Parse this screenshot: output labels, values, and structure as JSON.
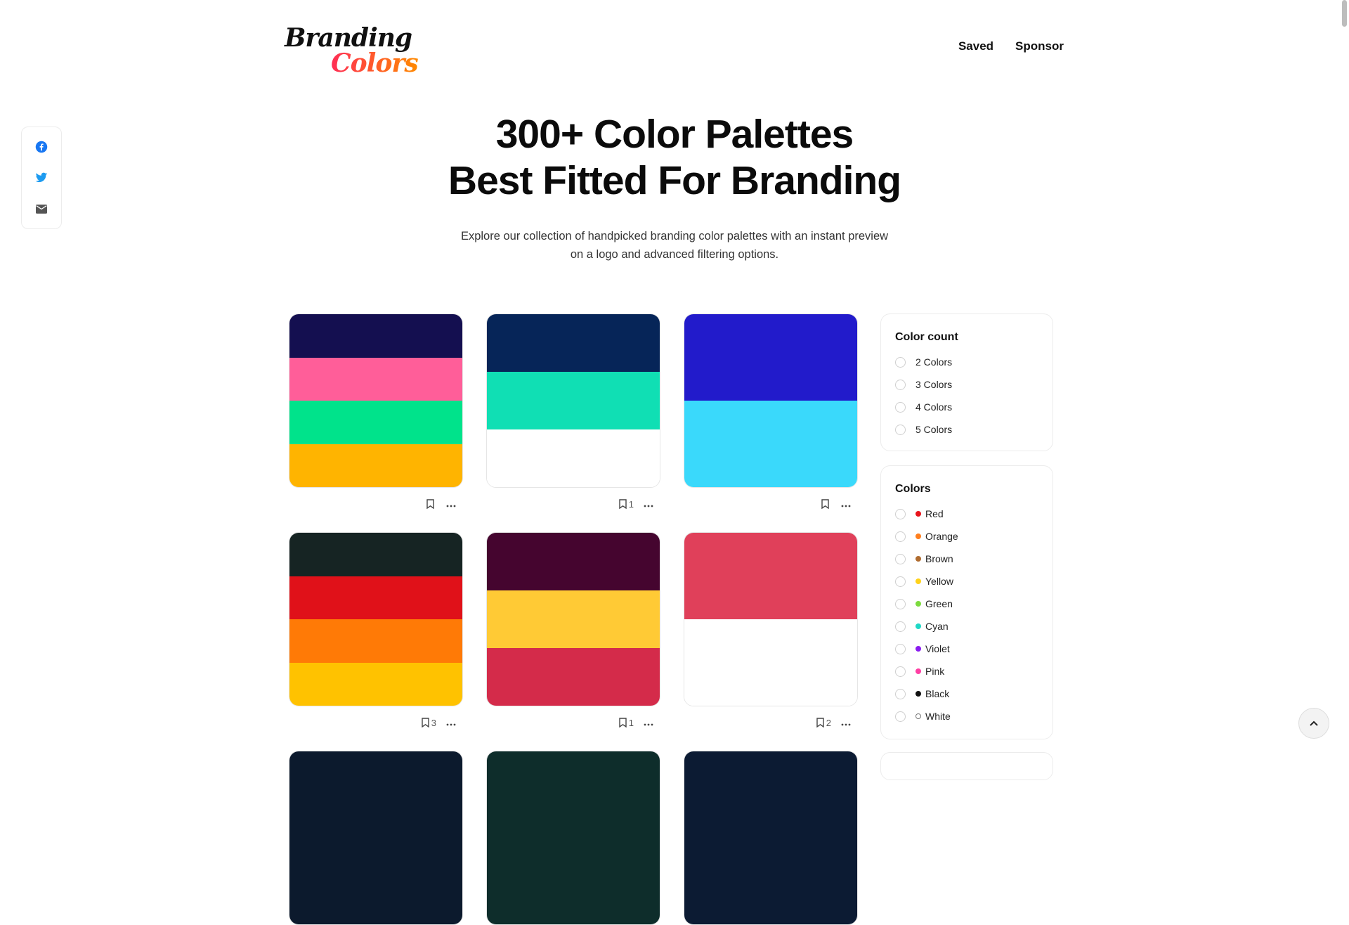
{
  "logo": {
    "line1": "Branding",
    "line2": "Colors"
  },
  "nav": {
    "saved": "Saved",
    "sponsor": "Sponsor"
  },
  "share": {
    "icons": [
      "facebook-icon",
      "twitter-icon",
      "mail-icon"
    ]
  },
  "hero": {
    "title_line1": "300+ Color Palettes",
    "title_line2": "Best Fitted For Branding",
    "subtitle_line1": "Explore our collection of handpicked branding color palettes with an instant preview",
    "subtitle_line2": "on a logo and advanced filtering options."
  },
  "palettes": [
    {
      "colors": [
        "#140f50",
        "#ff5e99",
        "#00e38b",
        "#ffb400"
      ],
      "saves": ""
    },
    {
      "colors": [
        "#062558",
        "#10dfb4",
        "#ffffff"
      ],
      "saves": "1"
    },
    {
      "colors": [
        "#221bcb",
        "#3ad9fb"
      ],
      "saves": ""
    },
    {
      "colors": [
        "#162423",
        "#e01119",
        "#ff7a06",
        "#ffc200"
      ],
      "saves": "3"
    },
    {
      "colors": [
        "#45052f",
        "#ffca35",
        "#d42b4a"
      ],
      "saves": "1"
    },
    {
      "colors": [
        "#e0405a",
        "#ffffff"
      ],
      "saves": "2"
    },
    {
      "colors": [
        "#0c1a2d"
      ],
      "saves": ""
    },
    {
      "colors": [
        "#0e2d2b"
      ],
      "saves": ""
    },
    {
      "colors": [
        "#0c1b33"
      ],
      "saves": ""
    }
  ],
  "filters": {
    "color_count": {
      "title": "Color count",
      "options": [
        "2 Colors",
        "3 Colors",
        "4 Colors",
        "5 Colors"
      ]
    },
    "colors": {
      "title": "Colors",
      "options": [
        {
          "label": "Red",
          "color": "#e8141c"
        },
        {
          "label": "Orange",
          "color": "#ff7f1e"
        },
        {
          "label": "Brown",
          "color": "#b06c30"
        },
        {
          "label": "Yellow",
          "color": "#ffd21a"
        },
        {
          "label": "Green",
          "color": "#7cdb3e"
        },
        {
          "label": "Cyan",
          "color": "#1fd8c6"
        },
        {
          "label": "Violet",
          "color": "#8a1cf0"
        },
        {
          "label": "Pink",
          "color": "#ff3fa4"
        },
        {
          "label": "Black",
          "color": "#111111"
        },
        {
          "label": "White",
          "color": "#ffffff"
        }
      ]
    }
  },
  "colors": {
    "facebook": "#1877f2",
    "twitter": "#1d9bf0",
    "mail": "#555555"
  }
}
